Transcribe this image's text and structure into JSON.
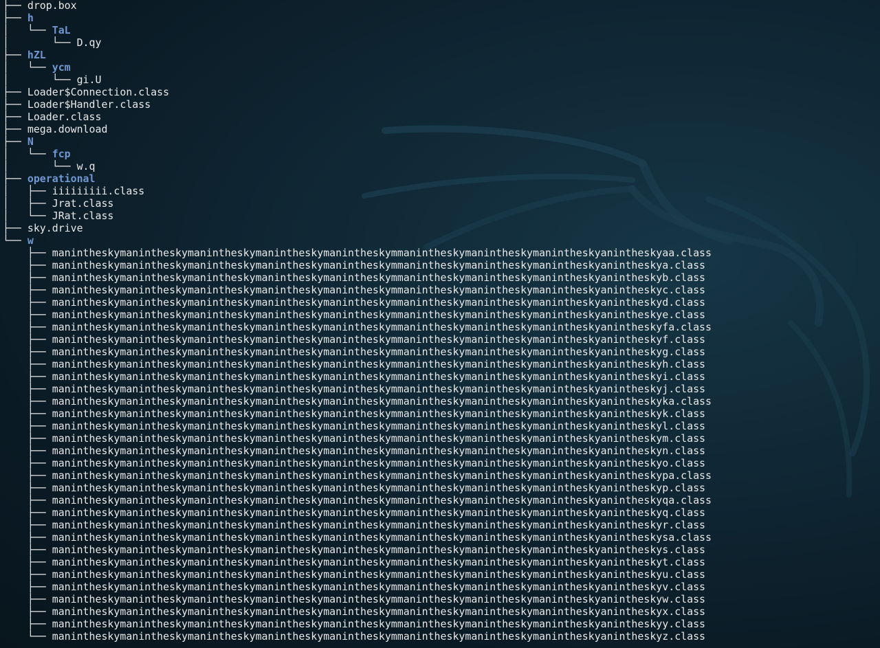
{
  "terminal": {
    "lines": [
      {
        "prefix": "├── ",
        "name": "drop.box",
        "type": "file"
      },
      {
        "prefix": "├── ",
        "name": "h",
        "type": "dir"
      },
      {
        "prefix": "│   └── ",
        "name": "TaL",
        "type": "dir"
      },
      {
        "prefix": "│       └── ",
        "name": "D.qy",
        "type": "file"
      },
      {
        "prefix": "├── ",
        "name": "hZL",
        "type": "dir"
      },
      {
        "prefix": "│   └── ",
        "name": "ycm",
        "type": "dir"
      },
      {
        "prefix": "│       └── ",
        "name": "gi.U",
        "type": "file"
      },
      {
        "prefix": "├── ",
        "name": "Loader$Connection.class",
        "type": "file"
      },
      {
        "prefix": "├── ",
        "name": "Loader$Handler.class",
        "type": "file"
      },
      {
        "prefix": "├── ",
        "name": "Loader.class",
        "type": "file"
      },
      {
        "prefix": "├── ",
        "name": "mega.download",
        "type": "file"
      },
      {
        "prefix": "├── ",
        "name": "N",
        "type": "dir"
      },
      {
        "prefix": "│   └── ",
        "name": "fcp",
        "type": "dir"
      },
      {
        "prefix": "│       └── ",
        "name": "w.q",
        "type": "file"
      },
      {
        "prefix": "├── ",
        "name": "operational",
        "type": "dir"
      },
      {
        "prefix": "│   ├── ",
        "name": "iiiiiiiii.class",
        "type": "file"
      },
      {
        "prefix": "│   ├── ",
        "name": "Jrat.class",
        "type": "file"
      },
      {
        "prefix": "│   └── ",
        "name": "JRat.class",
        "type": "file"
      },
      {
        "prefix": "├── ",
        "name": "sky.drive",
        "type": "file"
      },
      {
        "prefix": "└── ",
        "name": "w",
        "type": "dir"
      },
      {
        "prefix": "    ├── ",
        "name": "manintheskymanintheskymanintheskymanintheskymanintheskymmanintheskymanintheskymanintheskyanintheskyaa.class",
        "type": "file"
      },
      {
        "prefix": "    ├── ",
        "name": "manintheskymanintheskymanintheskymanintheskymanintheskymmanintheskymanintheskymanintheskyanintheskya.class",
        "type": "file"
      },
      {
        "prefix": "    ├── ",
        "name": "manintheskymanintheskymanintheskymanintheskymanintheskymmanintheskymanintheskymanintheskyanintheskyb.class",
        "type": "file"
      },
      {
        "prefix": "    ├── ",
        "name": "manintheskymanintheskymanintheskymanintheskymanintheskymmanintheskymanintheskymanintheskyanintheskyc.class",
        "type": "file"
      },
      {
        "prefix": "    ├── ",
        "name": "manintheskymanintheskymanintheskymanintheskymanintheskymmanintheskymanintheskymanintheskyanintheskyd.class",
        "type": "file"
      },
      {
        "prefix": "    ├── ",
        "name": "manintheskymanintheskymanintheskymanintheskymanintheskymmanintheskymanintheskymanintheskyanintheskye.class",
        "type": "file"
      },
      {
        "prefix": "    ├── ",
        "name": "manintheskymanintheskymanintheskymanintheskymanintheskymmanintheskymanintheskymanintheskyanintheskyfa.class",
        "type": "file"
      },
      {
        "prefix": "    ├── ",
        "name": "manintheskymanintheskymanintheskymanintheskymanintheskymmanintheskymanintheskymanintheskyanintheskyf.class",
        "type": "file"
      },
      {
        "prefix": "    ├── ",
        "name": "manintheskymanintheskymanintheskymanintheskymanintheskymmanintheskymanintheskymanintheskyanintheskyg.class",
        "type": "file"
      },
      {
        "prefix": "    ├── ",
        "name": "manintheskymanintheskymanintheskymanintheskymanintheskymmanintheskymanintheskymanintheskyanintheskyh.class",
        "type": "file"
      },
      {
        "prefix": "    ├── ",
        "name": "manintheskymanintheskymanintheskymanintheskymanintheskymmanintheskymanintheskymanintheskyanintheskyi.class",
        "type": "file"
      },
      {
        "prefix": "    ├── ",
        "name": "manintheskymanintheskymanintheskymanintheskymanintheskymmanintheskymanintheskymanintheskyanintheskyj.class",
        "type": "file"
      },
      {
        "prefix": "    ├── ",
        "name": "manintheskymanintheskymanintheskymanintheskymanintheskymmanintheskymanintheskymanintheskyanintheskyka.class",
        "type": "file"
      },
      {
        "prefix": "    ├── ",
        "name": "manintheskymanintheskymanintheskymanintheskymanintheskymmanintheskymanintheskymanintheskyanintheskyk.class",
        "type": "file"
      },
      {
        "prefix": "    ├── ",
        "name": "manintheskymanintheskymanintheskymanintheskymanintheskymmanintheskymanintheskymanintheskyanintheskyl.class",
        "type": "file"
      },
      {
        "prefix": "    ├── ",
        "name": "manintheskymanintheskymanintheskymanintheskymanintheskymmanintheskymanintheskymanintheskyanintheskym.class",
        "type": "file"
      },
      {
        "prefix": "    ├── ",
        "name": "manintheskymanintheskymanintheskymanintheskymanintheskymmanintheskymanintheskymanintheskyanintheskyn.class",
        "type": "file"
      },
      {
        "prefix": "    ├── ",
        "name": "manintheskymanintheskymanintheskymanintheskymanintheskymmanintheskymanintheskymanintheskyanintheskyo.class",
        "type": "file"
      },
      {
        "prefix": "    ├── ",
        "name": "manintheskymanintheskymanintheskymanintheskymanintheskymmanintheskymanintheskymanintheskyanintheskypa.class",
        "type": "file"
      },
      {
        "prefix": "    ├── ",
        "name": "manintheskymanintheskymanintheskymanintheskymanintheskymmanintheskymanintheskymanintheskyanintheskyp.class",
        "type": "file"
      },
      {
        "prefix": "    ├── ",
        "name": "manintheskymanintheskymanintheskymanintheskymanintheskymmanintheskymanintheskymanintheskyanintheskyqa.class",
        "type": "file"
      },
      {
        "prefix": "    ├── ",
        "name": "manintheskymanintheskymanintheskymanintheskymanintheskymmanintheskymanintheskymanintheskyanintheskyq.class",
        "type": "file"
      },
      {
        "prefix": "    ├── ",
        "name": "manintheskymanintheskymanintheskymanintheskymanintheskymmanintheskymanintheskymanintheskyanintheskyr.class",
        "type": "file"
      },
      {
        "prefix": "    ├── ",
        "name": "manintheskymanintheskymanintheskymanintheskymanintheskymmanintheskymanintheskymanintheskyanintheskysa.class",
        "type": "file"
      },
      {
        "prefix": "    ├── ",
        "name": "manintheskymanintheskymanintheskymanintheskymanintheskymmanintheskymanintheskymanintheskyanintheskys.class",
        "type": "file"
      },
      {
        "prefix": "    ├── ",
        "name": "manintheskymanintheskymanintheskymanintheskymanintheskymmanintheskymanintheskymanintheskyanintheskyt.class",
        "type": "file"
      },
      {
        "prefix": "    ├── ",
        "name": "manintheskymanintheskymanintheskymanintheskymanintheskymmanintheskymanintheskymanintheskyanintheskyu.class",
        "type": "file"
      },
      {
        "prefix": "    ├── ",
        "name": "manintheskymanintheskymanintheskymanintheskymanintheskymmanintheskymanintheskymanintheskyanintheskyv.class",
        "type": "file"
      },
      {
        "prefix": "    ├── ",
        "name": "manintheskymanintheskymanintheskymanintheskymanintheskymmanintheskymanintheskymanintheskyanintheskyw.class",
        "type": "file"
      },
      {
        "prefix": "    ├── ",
        "name": "manintheskymanintheskymanintheskymanintheskymanintheskymmanintheskymanintheskymanintheskyanintheskyx.class",
        "type": "file"
      },
      {
        "prefix": "    ├── ",
        "name": "manintheskymanintheskymanintheskymanintheskymanintheskymmanintheskymanintheskymanintheskyanintheskyy.class",
        "type": "file"
      },
      {
        "prefix": "    └── ",
        "name": "manintheskymanintheskymanintheskymanintheskymanintheskymmanintheskymanintheskymanintheskyanintheskyz.class",
        "type": "file"
      }
    ]
  },
  "colors": {
    "directory": "#6f97d1",
    "file": "#e9e9e9",
    "background": "#0f2532"
  },
  "wallpaper": {
    "icon": "kali-dragon-logo"
  }
}
